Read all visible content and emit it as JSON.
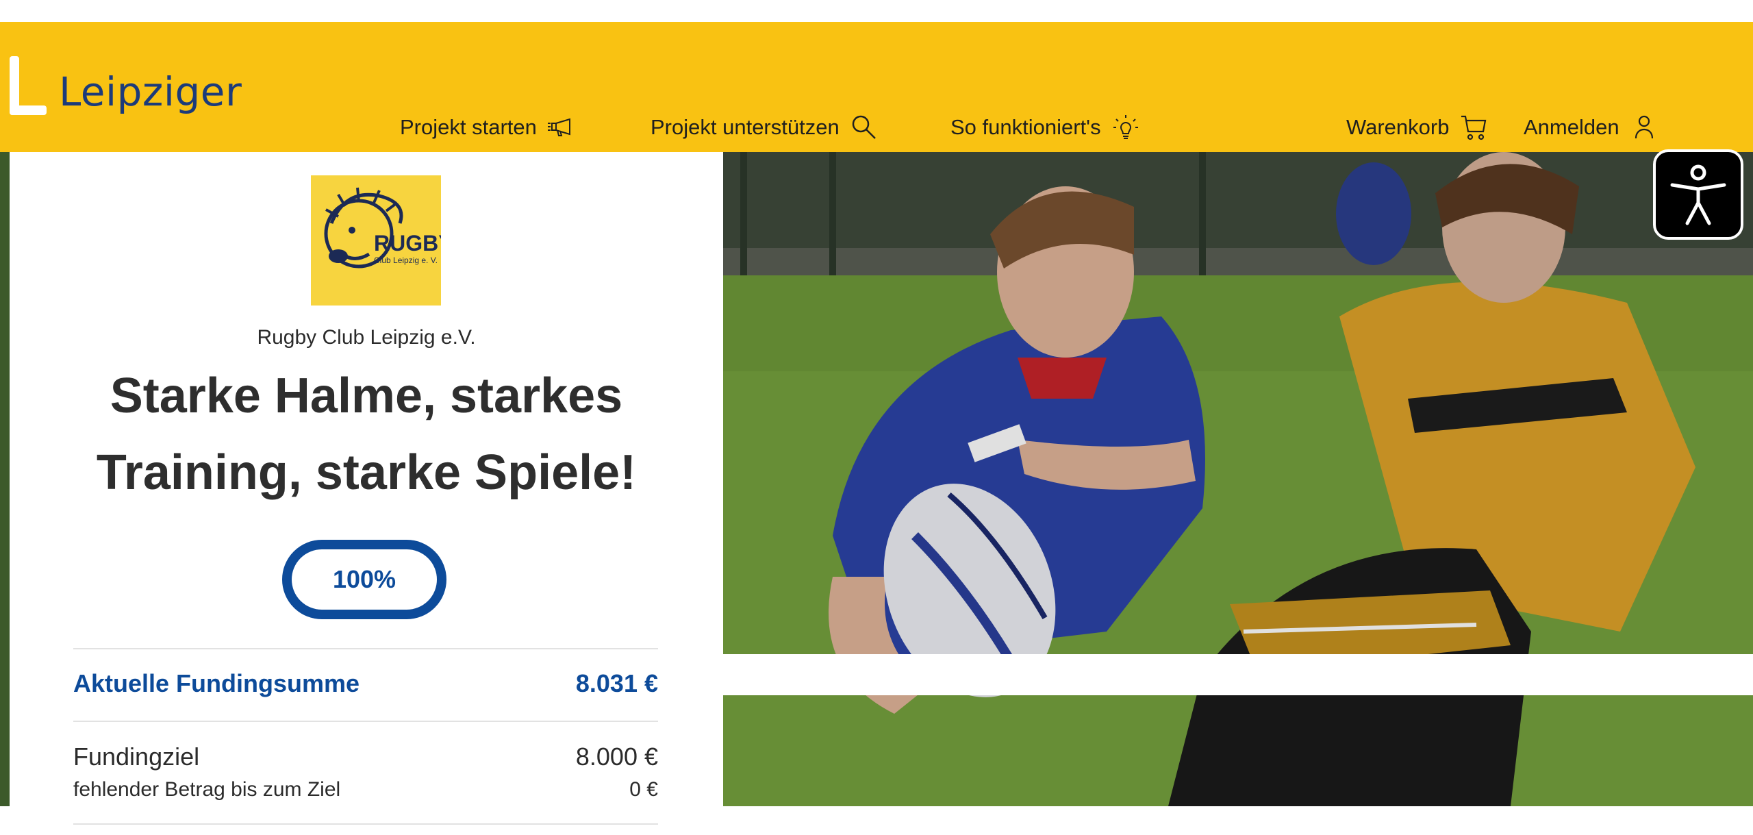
{
  "header": {
    "logo_text": "Leipziger",
    "nav": {
      "start_project": "Projekt starten",
      "support_project": "Projekt unterstützen",
      "how_it_works": "So funktioniert's",
      "cart": "Warenkorb",
      "login": "Anmelden"
    }
  },
  "project": {
    "club_name": "Rugby Club Leipzig e.V.",
    "club_logo": {
      "line1": "RUGBY",
      "line2": "Club Leipzig e. V."
    },
    "title": "Starke Halme, starkes Training, starke Spiele!",
    "progress_label": "100%",
    "progress_percent": 100,
    "current_funding_label": "Aktuelle Fundingsumme",
    "current_funding_value": "8.031 €",
    "goal_label": "Fundingziel",
    "goal_value": "8.000 €",
    "missing_label": "fehlender Betrag bis zum Ziel",
    "missing_value": "0 €"
  },
  "colors": {
    "brand_yellow": "#f9c212",
    "brand_blue": "#0d4b9a",
    "logo_blue": "#1c3b7a"
  },
  "icons": [
    "megaphone-icon",
    "search-icon",
    "lightbulb-icon",
    "cart-icon",
    "user-icon",
    "accessibility-icon"
  ]
}
